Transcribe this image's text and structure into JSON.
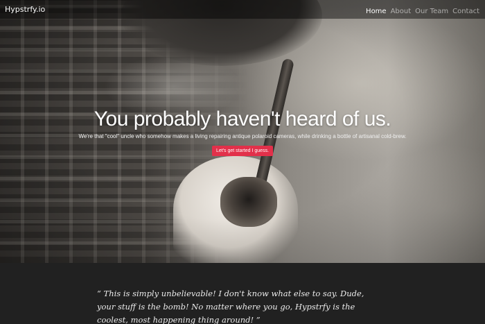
{
  "navbar": {
    "brand": "Hypstrfy.io",
    "links": [
      {
        "label": "Home",
        "active": true
      },
      {
        "label": "About",
        "active": false
      },
      {
        "label": "Our Team",
        "active": false
      },
      {
        "label": "Contact",
        "active": false
      }
    ]
  },
  "hero": {
    "title": "You probably haven't heard of us.",
    "subtitle": "We're that \"cool\" uncle who somehow makes a living repairing antique polaroid cameras, while drinking a bottle of artisanal cold-brew.",
    "cta_label": "Let's get started I guess."
  },
  "testimonial": {
    "quote": "“ This is simply unbelievable! I don't know what else to say. Dude, your stuff is the bomb! No matter where you go, Hypstrfy is the coolest, most happening thing around! ”"
  },
  "colors": {
    "cta": "#e2304a",
    "dark_section": "#212121",
    "nav_active": "#ffffff"
  }
}
